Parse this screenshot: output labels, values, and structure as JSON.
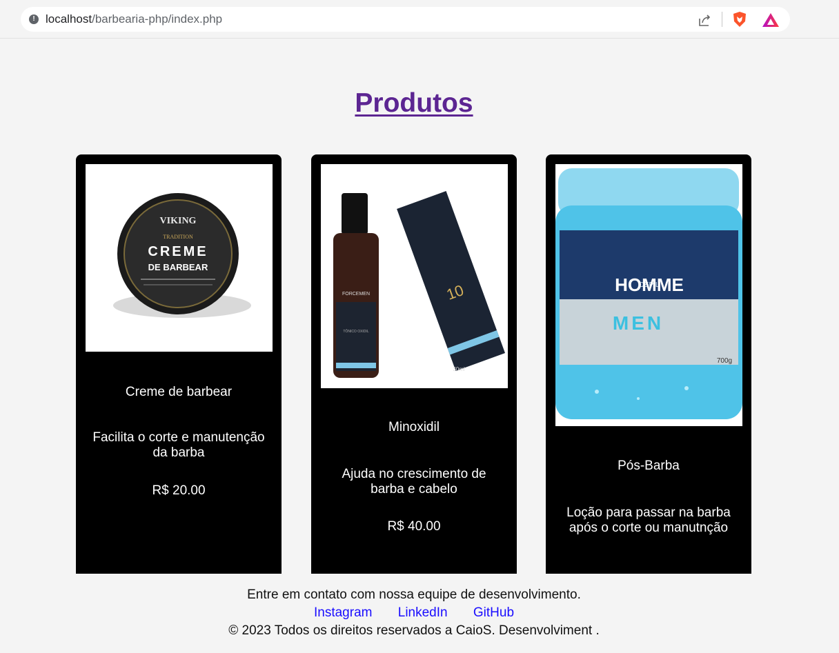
{
  "browser": {
    "url_host": "localhost",
    "url_path": "/barbearia-php/index.php"
  },
  "page": {
    "title": "Produtos"
  },
  "products": [
    {
      "name": "Creme de barbear",
      "description": "Facilita o corte e manutenção da barba",
      "price": "R$ 20.00",
      "image_brand": "VIKING",
      "image_line1": "TRADITION",
      "image_line2": "CREME",
      "image_line3": "DE BARBEAR"
    },
    {
      "name": "Minoxidil",
      "description": "Ajuda no crescimento de barba e cabelo",
      "price": "R$ 40.00",
      "image_brand": "FORCEMEN",
      "image_line1": "10",
      "image_line2": "TÔNICO OXIDIL",
      "image_line3": "30ml"
    },
    {
      "name": "Pós-Barba",
      "description": "Loção para passar na barba após o corte ou manutnção",
      "price": "",
      "image_brand": "HOMME",
      "image_line1": "DEPIL",
      "image_line2": "MEN",
      "image_line3": "700g"
    }
  ],
  "footer": {
    "contact_text": "Entre em contato com nossa equipe de desenvolvimento.",
    "links": [
      "Instagram",
      "LinkedIn",
      "GitHub"
    ],
    "copyright": "© 2023 Todos os direitos reservados a CaioS. Desenvolviment ."
  },
  "colors": {
    "title": "#5c2592",
    "link": "#1a0dff",
    "card_bg": "#000000",
    "page_bg": "#f4f4f4"
  }
}
